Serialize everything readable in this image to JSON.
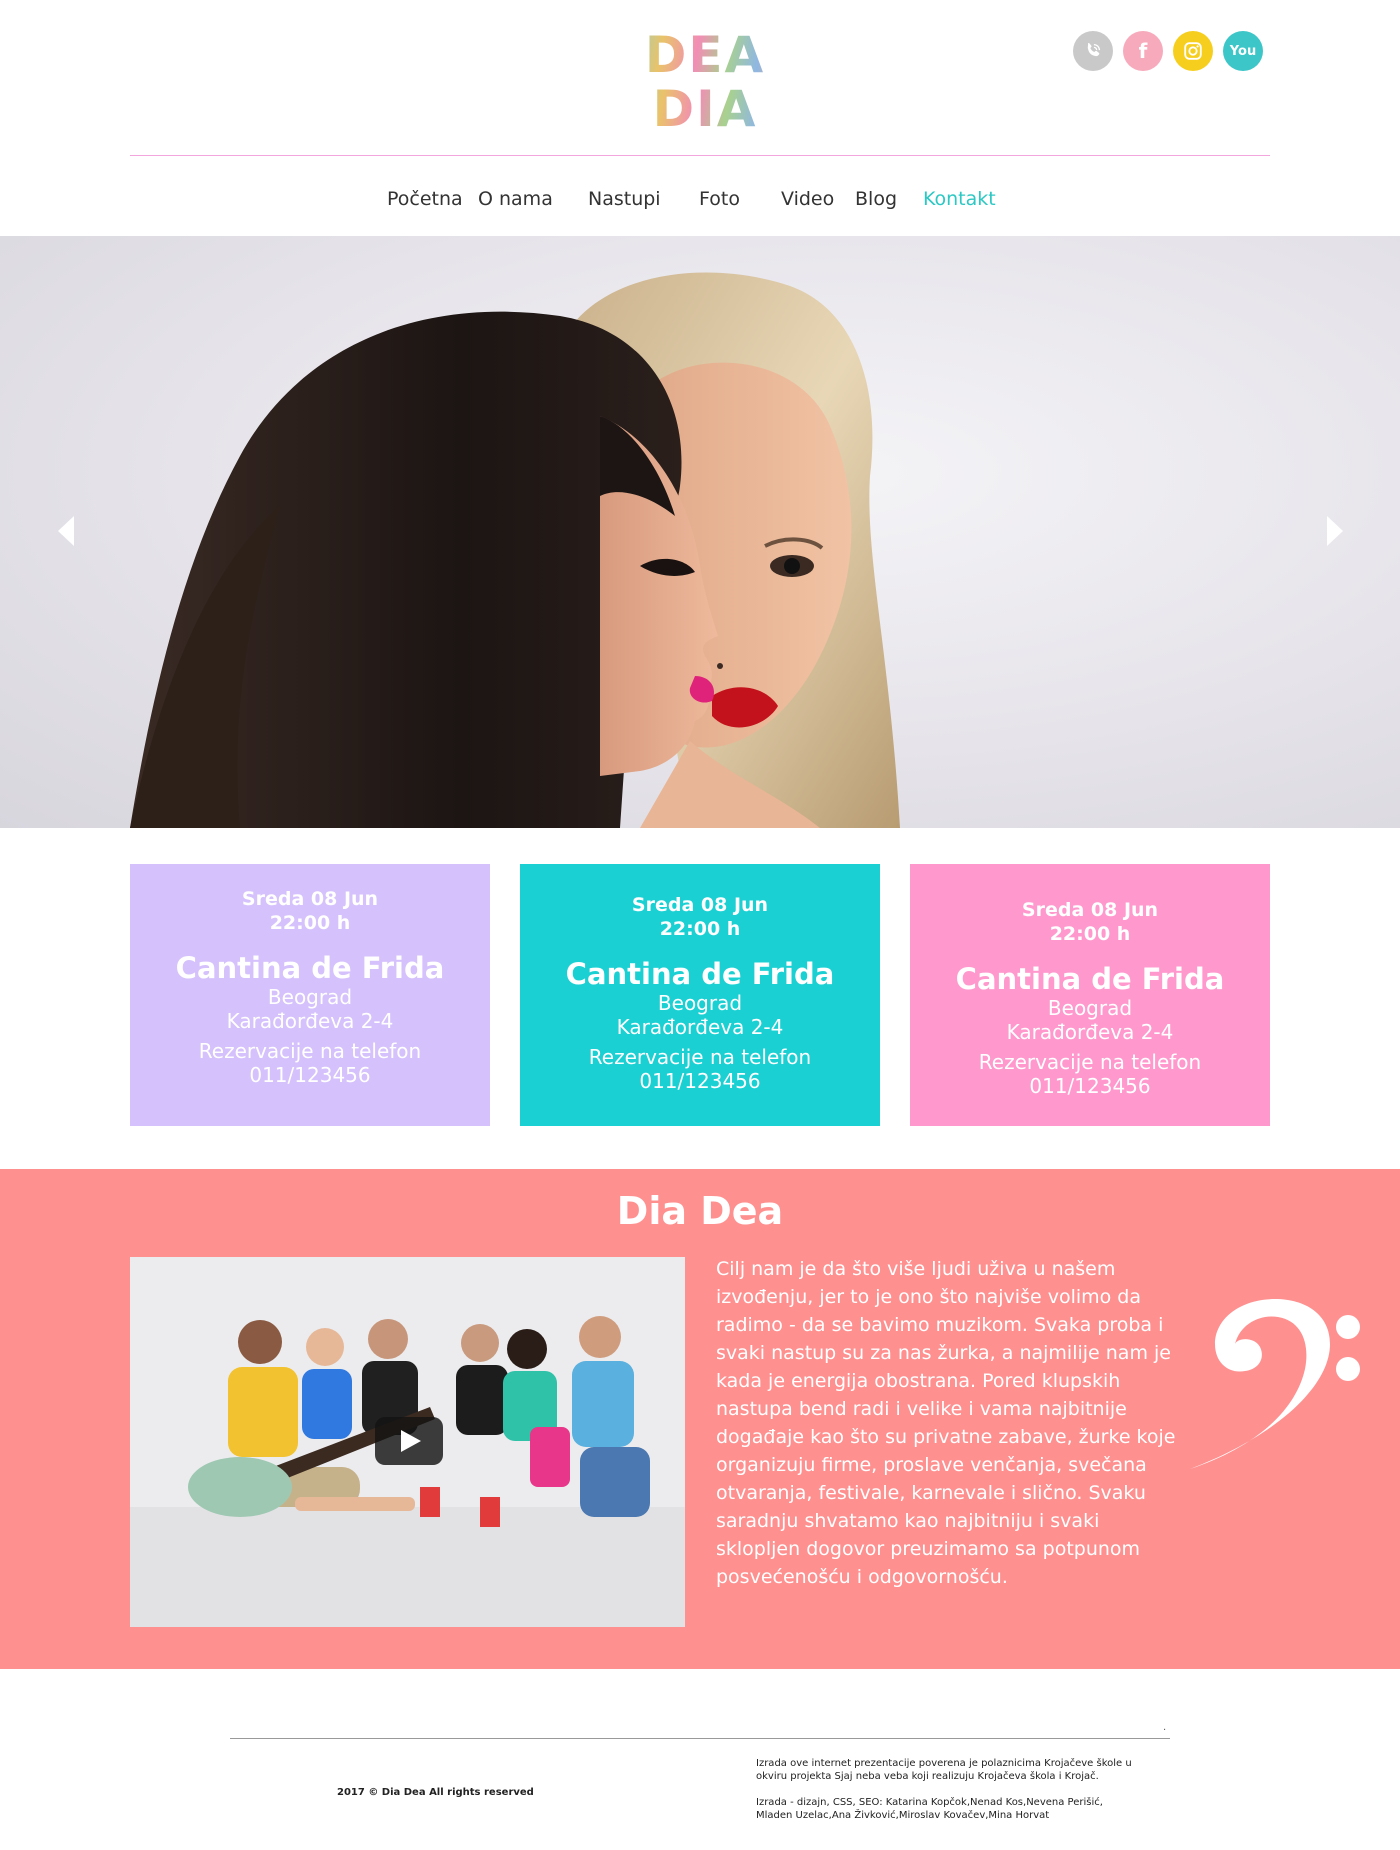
{
  "header": {
    "logo": {
      "line1": "DEA",
      "line2": "DIA"
    },
    "social": [
      {
        "name": "viber",
        "icon": "phone-icon",
        "color": "#c9c9c9",
        "label": ""
      },
      {
        "name": "facebook",
        "icon": "facebook-icon",
        "color": "#f7aabb",
        "label": "f"
      },
      {
        "name": "instagram",
        "icon": "instagram-icon",
        "color": "#f6cf1e",
        "label": ""
      },
      {
        "name": "youtube",
        "icon": "youtube-icon",
        "color": "#3cc6c8",
        "label": "You"
      }
    ]
  },
  "nav": {
    "items": [
      "Početna",
      "O nama",
      "Nastupi",
      "Foto",
      "Video",
      "Blog",
      "Kontakt"
    ],
    "active": "Kontakt",
    "active_color": "#2cc8c4"
  },
  "events": [
    {
      "day": "Sreda 08 Jun",
      "time": "22:00 h",
      "venue": "Cantina de Frida",
      "city": "Beograd",
      "address": "Karađorđeva 2-4",
      "reserve": "Rezervacije na telefon",
      "phone": "011/123456",
      "color": "#d5c1fb"
    },
    {
      "day": "Sreda 08 Jun",
      "time": "22:00 h",
      "venue": "Cantina de Frida",
      "city": "Beograd",
      "address": "Karađorđeva 2-4",
      "reserve": "Rezervacije na telefon",
      "phone": "011/123456",
      "color": "#1ad0d3"
    },
    {
      "day": "Sreda 08 Jun",
      "time": "22:00 h",
      "venue": "Cantina de Frida",
      "city": "Beograd",
      "address": "Karađorđeva 2-4",
      "reserve": "Rezervacije na telefon",
      "phone": "011/123456",
      "color": "#ff99cd"
    }
  ],
  "about": {
    "title": "Dia Dea",
    "background": "#ff9090",
    "text": "Cilj nam je da što više ljudi uživa u našem izvođenju, jer to je ono što najviše volimo da radimo - da se bavimo muzikom. Svaka proba i svaki nastup su za nas žurka, a najmilije nam je kada je energija obostrana. Pored klupskih nastupa bend radi i velike i vama najbitnije događaje kao što su privatne zabave, žurke koje organizuju firme, proslave venčanja, svečana otvaranja, festivale, karnevale i slično. Svaku saradnju shvatamo kao najbitniju i svaki sklopljen dogovor preuzimamo sa potpunom posvećenošću i odgovornošću."
  },
  "footer": {
    "dot": ".",
    "copyright": "2017 © Dia Dea All rights reserved",
    "credits": [
      "Izrada ove internet prezentacije poverena je polaznicima Krojačeve škole u okviru projekta Sjaj neba veba koji realizuju Krojačeva škola i Krojač.",
      "Izrada - dizajn, CSS, SEO: Katarina Kopčok,Nenad Kos,Nevena Perišić, Mladen Uzelac,Ana Živković,Miroslav Kovačev,Mina Horvat"
    ]
  }
}
